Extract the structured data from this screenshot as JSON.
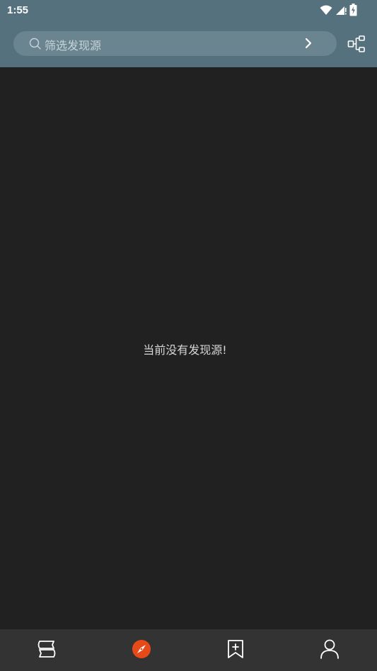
{
  "status_bar": {
    "time": "1:55",
    "icons": [
      "wifi-icon",
      "signal-icon",
      "battery-icon"
    ]
  },
  "search": {
    "placeholder": "筛选发现源",
    "icon": "search-icon",
    "go_icon": "chevron-right-icon"
  },
  "toolbar": {
    "group_icon": "group-tree-icon"
  },
  "main": {
    "empty_message": "当前没有发现源!"
  },
  "bottom_nav": {
    "items": [
      {
        "icon": "bookshelf-icon",
        "active": false
      },
      {
        "icon": "explore-compass-icon",
        "active": true
      },
      {
        "icon": "rss-bookmark-icon",
        "active": false
      },
      {
        "icon": "profile-icon",
        "active": false
      }
    ]
  },
  "colors": {
    "top_bar": "#55717d",
    "background": "#212121",
    "bottom_nav": "#333333",
    "accent": "#e64a19"
  }
}
